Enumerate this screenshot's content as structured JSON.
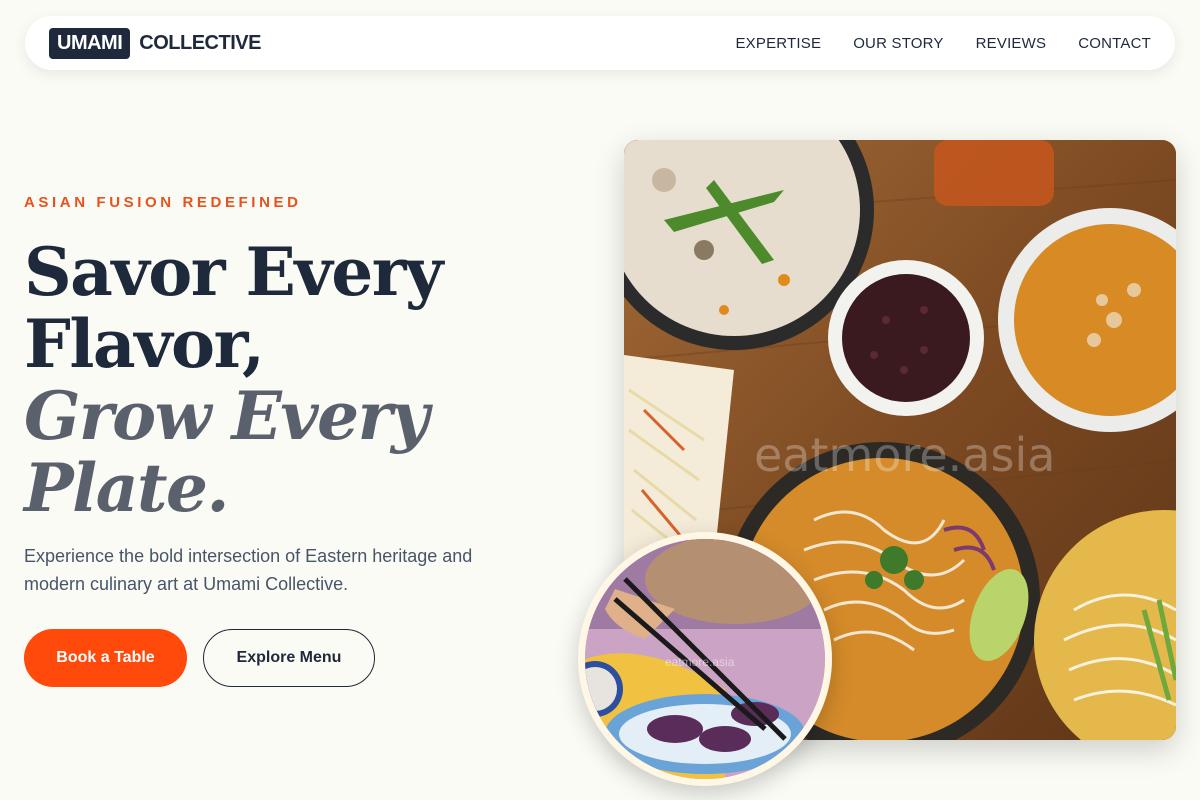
{
  "nav": {
    "brand_badge": "UMAMI",
    "brand_name": "COLLECTIVE",
    "links": [
      "EXPERTISE",
      "OUR STORY",
      "REVIEWS",
      "CONTACT"
    ]
  },
  "hero": {
    "eyebrow": "ASIAN FUSION REDEFINED",
    "headline_lines": [
      "Savor Every",
      "Flavor,"
    ],
    "headline_italic_lines": [
      "Grow Every",
      "Plate."
    ],
    "description": "Experience the bold intersection of Eastern heritage and modern culinary art at Umami Collective.",
    "primary_button": "Book a Table",
    "secondary_button": "Explore Menu"
  },
  "images": {
    "main_watermark": "eatmore.asia",
    "inset_watermark": "eatmore.asia"
  },
  "colors": {
    "accent": "#ff4a0c",
    "eyebrow": "#e8521c",
    "navy": "#1e293b",
    "background": "#fbfbf5"
  }
}
